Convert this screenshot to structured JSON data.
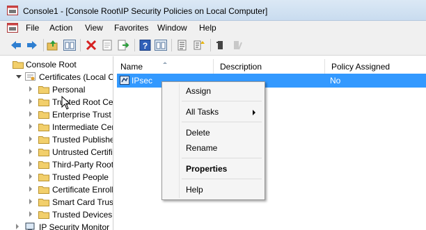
{
  "window": {
    "title": "Console1 - [Console Root\\IP Security Policies on Local Computer]"
  },
  "menubar": {
    "items": [
      "File",
      "Action",
      "View",
      "Favorites",
      "Window",
      "Help"
    ]
  },
  "toolbar": {
    "buttons": [
      "back-icon",
      "forward-icon",
      "up-folder-icon",
      "show-hide-tree-icon",
      "delete-icon",
      "properties-icon",
      "export-list-icon",
      "help-icon",
      "show-hide-action-pane-icon",
      "manage-filter-lists-icon",
      "assign-policy-icon",
      "unassign-policy-icon"
    ]
  },
  "tree": {
    "root": "Console Root",
    "certificates": "Certificates (Local C",
    "children": [
      "Personal",
      "Trusted Root Ce",
      "Enterprise Trust",
      "Intermediate Cer",
      "Trusted Publishe",
      "Untrusted Certifi",
      "Third-Party Root",
      "Trusted People",
      "Certificate Enroll",
      "Smart Card Trus",
      "Trusted Devices"
    ],
    "ipsec_monitor": "IP Security Monitor"
  },
  "list": {
    "columns": [
      "Name",
      "Description",
      "Policy Assigned"
    ],
    "rows": [
      {
        "name": "IPsec",
        "description": "",
        "policy_assigned": "No"
      }
    ]
  },
  "context_menu": {
    "assign": "Assign",
    "all_tasks": "All Tasks",
    "delete": "Delete",
    "rename": "Rename",
    "properties": "Properties",
    "help": "Help"
  },
  "colors": {
    "selection": "#3399ff",
    "titlebar": "#dbe8f5",
    "folder": "#f2cf6b"
  }
}
